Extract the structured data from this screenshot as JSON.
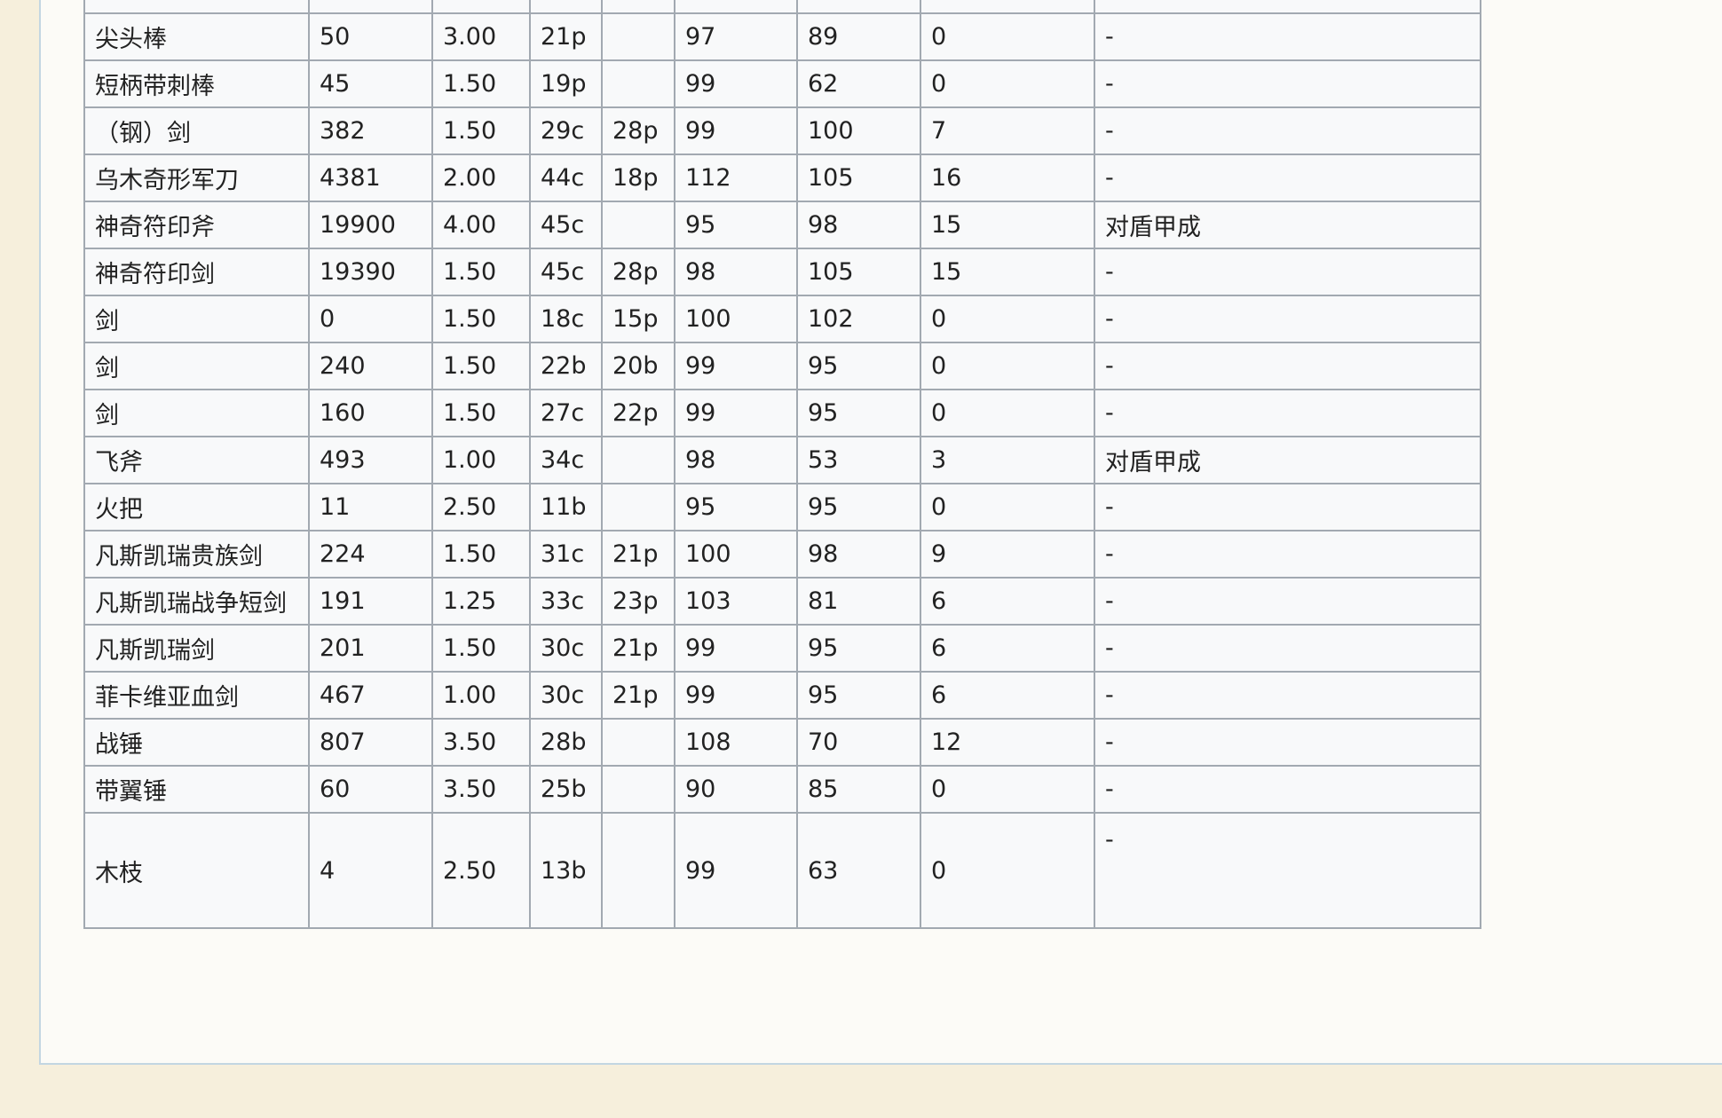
{
  "table": {
    "rows": [
      [
        "",
        "",
        "",
        "",
        "",
        "",
        "",
        "",
        ""
      ],
      [
        "尖头棒",
        "50",
        "3.00",
        "21p",
        "",
        "97",
        "89",
        "0",
        "-"
      ],
      [
        "短柄带刺棒",
        "45",
        "1.50",
        "19p",
        "",
        "99",
        "62",
        "0",
        "-"
      ],
      [
        "（钢）剑",
        "382",
        "1.50",
        "29c",
        "28p",
        "99",
        "100",
        "7",
        "-"
      ],
      [
        "乌木奇形军刀",
        "4381",
        "2.00",
        "44c",
        "18p",
        "112",
        "105",
        "16",
        "-"
      ],
      [
        "神奇符印斧",
        "19900",
        "4.00",
        "45c",
        "",
        "95",
        "98",
        "15",
        "对盾甲成"
      ],
      [
        "神奇符印剑",
        "19390",
        "1.50",
        "45c",
        "28p",
        "98",
        "105",
        "15",
        "-"
      ],
      [
        "剑",
        "0",
        "1.50",
        "18c",
        "15p",
        "100",
        "102",
        "0",
        "-"
      ],
      [
        "剑",
        "240",
        "1.50",
        "22b",
        "20b",
        "99",
        "95",
        "0",
        "-"
      ],
      [
        "剑",
        "160",
        "1.50",
        "27c",
        "22p",
        "99",
        "95",
        "0",
        "-"
      ],
      [
        "飞斧",
        "493",
        "1.00",
        "34c",
        "",
        "98",
        "53",
        "3",
        "对盾甲成"
      ],
      [
        "火把",
        "11",
        "2.50",
        "11b",
        "",
        "95",
        "95",
        "0",
        "-"
      ],
      [
        "凡斯凯瑞贵族剑",
        "224",
        "1.50",
        "31c",
        "21p",
        "100",
        "98",
        "9",
        "-"
      ],
      [
        "凡斯凯瑞战争短剑",
        "191",
        "1.25",
        "33c",
        "23p",
        "103",
        "81",
        "6",
        "-"
      ],
      [
        "凡斯凯瑞剑",
        "201",
        "1.50",
        "30c",
        "21p",
        "99",
        "95",
        "6",
        "-"
      ],
      [
        "菲卡维亚血剑",
        "467",
        "1.00",
        "30c",
        "21p",
        "99",
        "95",
        "6",
        "-"
      ],
      [
        "战锤",
        "807",
        "3.50",
        "28b",
        "",
        "108",
        "70",
        "12",
        "-"
      ],
      [
        "带翼锤",
        "60",
        "3.50",
        "25b",
        "",
        "90",
        "85",
        "0",
        "-"
      ],
      [
        "木枝",
        "4",
        "2.50",
        "13b",
        "",
        "99",
        "63",
        "0",
        "-"
      ]
    ]
  },
  "footer": {
    "text": ""
  }
}
